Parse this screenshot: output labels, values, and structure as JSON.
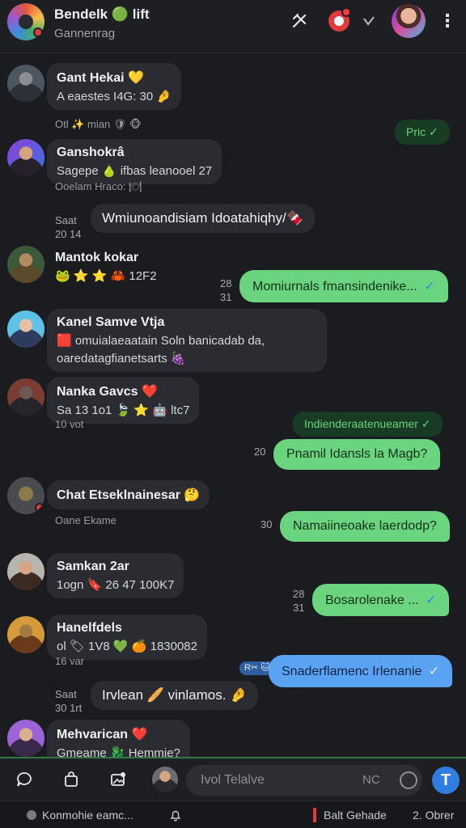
{
  "header": {
    "title": "Bendelk 🟢 lift",
    "subtitle": "Gannenrag",
    "menu_glyph": "⋮"
  },
  "messages_in": [
    {
      "name": "Gant Hekai 💛",
      "text": "A eaestes I4G: 30 🤌"
    },
    {
      "name": "Ganshokrâ",
      "text": "Sagepe 🍐 ifbas leanooel 27"
    },
    {
      "name": "Mantok kokar",
      "text": "🐸 ⭐ ⭐ 🦀 12F2"
    },
    {
      "name": "Kanel Samve Vtja",
      "text": "🟥 omuialaeaatain Soln banicadab da,",
      "text2": "oaredatagfianetsarts 🍇"
    },
    {
      "name": "Nanka Gavcs ❤️",
      "text": "Sa 13 1o1 🍃 ⭐ 🤖 ltc7"
    },
    {
      "name": "Chat Etseklnainesar 🤔",
      "text": ""
    },
    {
      "name": "Samkan 2ar",
      "text": "1ogn 🔖 26 47 100K7"
    },
    {
      "name": "Hanelfdels",
      "text": "ol 🏷 1V8 💚 🍊 1830082"
    },
    {
      "name": "Mehvarican ❤️",
      "text": "Gmeame 🐉 Hemmie?"
    }
  ],
  "plain_bubbles": [
    {
      "text": "Wmiunoandisiam Idoatahiqhy/🍫"
    },
    {
      "text": "Irvlean 🥖 vinlamos. 🤌"
    }
  ],
  "meta": {
    "m1": "Otl ✨ mian 🛡  🐵",
    "m2": "Ooelam Hraco: 🍽",
    "m3": "10 vot",
    "m4": "Oane Ekame",
    "m5": "16 var"
  },
  "stamps": {
    "s1a": "Saat",
    "s1b": "20 14",
    "s2a": "28",
    "s2b": "31",
    "s3": "20",
    "s4": "30",
    "s5a": "28",
    "s5b": "31",
    "s6a": "Saat",
    "s6b": "30 1rt"
  },
  "messages_out": [
    {
      "text": "Pric",
      "tick": "✓"
    },
    {
      "text": "Momiurnals fmansindenike... ",
      "tick": "✓"
    },
    {
      "text": "Indienderaatenueamer ",
      "tick": "✓"
    },
    {
      "text": "Pnamil Idansls la Magb?"
    },
    {
      "text": "Namaiineoake laerdodp?"
    },
    {
      "text": "Bosarolenake ... ",
      "tick": "✓"
    },
    {
      "text": "Snaderflamenc Irlenanie ",
      "tick": "✓",
      "tag": "R✂ 🐱"
    }
  ],
  "composer": {
    "placeholder": "Ivol Telalve",
    "hint": "NC",
    "send_glyph": "T"
  },
  "status_bar": {
    "left": "Konmohie eamc...",
    "right": "Balt Gehade",
    "count": "2. Obrer"
  },
  "colors": {
    "background": "#1b1c20",
    "incoming_bubble": "#2b2c31",
    "outgoing_bubble": "#6bd47e",
    "outgoing_blue": "#5aa2f2",
    "accent": "#2f7de0",
    "badge": "#e23b3b"
  }
}
